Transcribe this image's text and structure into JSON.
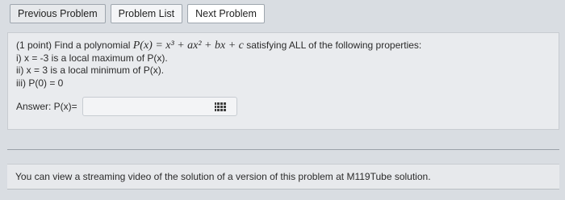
{
  "nav": {
    "previous_label": "Previous Problem",
    "list_label": "Problem List",
    "next_label": "Next Problem"
  },
  "problem": {
    "intro_prefix": "(1 point) Find a polynomial",
    "formula": "P(x) = x³ + ax² + bx + c",
    "intro_suffix": "satisfying ALL of the following properties:",
    "prop1": "i) x = -3 is a local maximum of P(x).",
    "prop2": "ii) x = 3 is a local minimum of P(x).",
    "prop3": "iii) P(0) = 0",
    "answer_label": "Answer: P(x)=",
    "answer_value": ""
  },
  "footer": {
    "text_prefix": "You can view a streaming video of the solution of a version of this problem at",
    "link_text": "M119Tube solution",
    "text_suffix": "."
  },
  "icons": {
    "answer_helper": "grid-icon"
  }
}
